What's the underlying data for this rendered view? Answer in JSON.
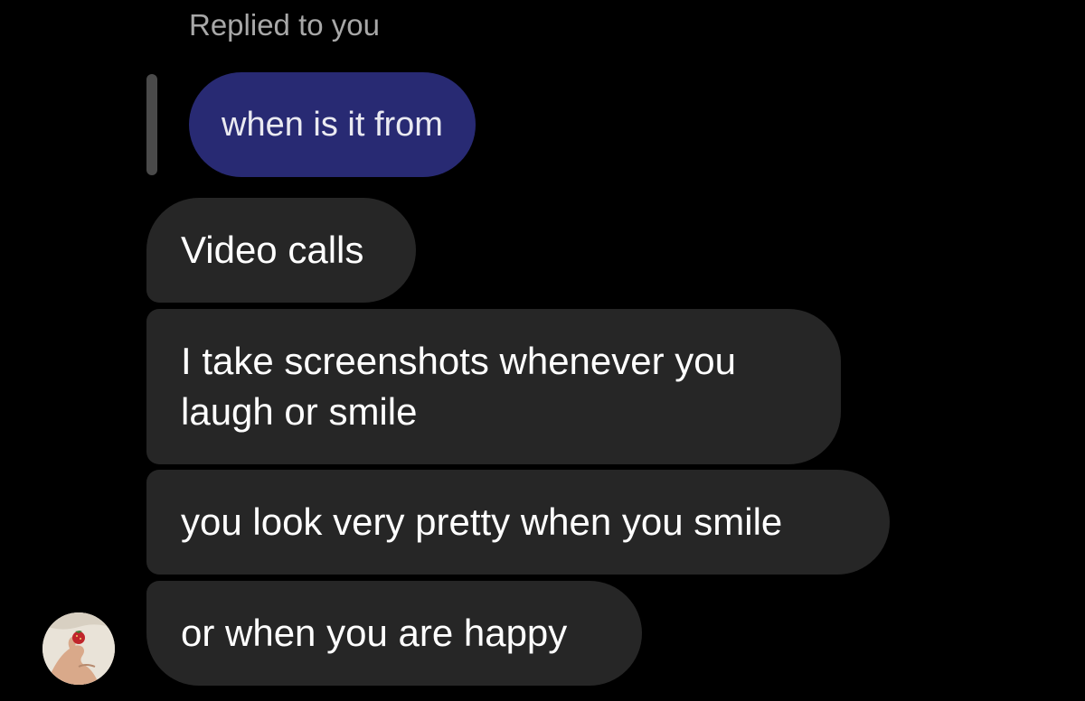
{
  "reply": {
    "label": "Replied to you",
    "quoted_message": "when is it from",
    "quoted_bubble_color": "#282a73"
  },
  "messages": [
    {
      "text": "Video calls"
    },
    {
      "lines": [
        "I take screenshots whenever you",
        "laugh or smile"
      ]
    },
    {
      "text": "you look very pretty when you smile"
    },
    {
      "text": "or when you are happy"
    }
  ],
  "colors": {
    "background": "#000000",
    "incoming_bubble": "#262626",
    "reply_label": "#a8a8a8"
  },
  "avatar": {
    "icon": "profile-photo-hand-holding-strawberry-icon"
  }
}
